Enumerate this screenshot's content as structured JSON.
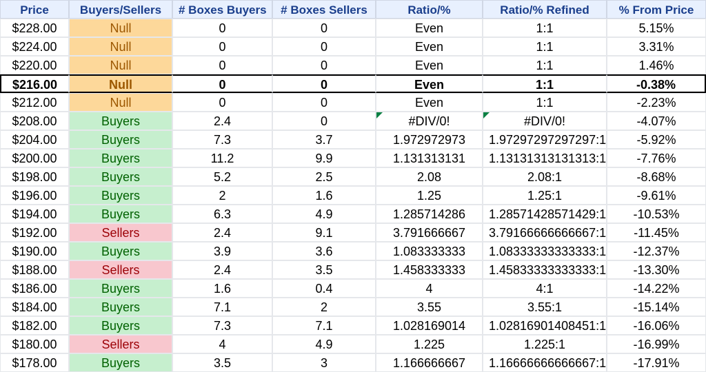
{
  "headers": [
    "Price",
    "Buyers/Sellers",
    "# Boxes Buyers",
    "# Boxes Sellers",
    "Ratio/%",
    "Ratio/% Refined",
    "% From Price"
  ],
  "rows": [
    {
      "price": "$228.00",
      "bs": "Null",
      "bs_class": "bs-null",
      "boxes_buyers": "0",
      "boxes_sellers": "0",
      "ratio": "Even",
      "ratio_refined": "1:1",
      "pct": "5.15%",
      "highlight": false,
      "err": false
    },
    {
      "price": "$224.00",
      "bs": "Null",
      "bs_class": "bs-null",
      "boxes_buyers": "0",
      "boxes_sellers": "0",
      "ratio": "Even",
      "ratio_refined": "1:1",
      "pct": "3.31%",
      "highlight": false,
      "err": false
    },
    {
      "price": "$220.00",
      "bs": "Null",
      "bs_class": "bs-null",
      "boxes_buyers": "0",
      "boxes_sellers": "0",
      "ratio": "Even",
      "ratio_refined": "1:1",
      "pct": "1.46%",
      "highlight": false,
      "err": false
    },
    {
      "price": "$216.00",
      "bs": "Null",
      "bs_class": "bs-null",
      "boxes_buyers": "0",
      "boxes_sellers": "0",
      "ratio": "Even",
      "ratio_refined": "1:1",
      "pct": "-0.38%",
      "highlight": true,
      "err": false
    },
    {
      "price": "$212.00",
      "bs": "Null",
      "bs_class": "bs-null",
      "boxes_buyers": "0",
      "boxes_sellers": "0",
      "ratio": "Even",
      "ratio_refined": "1:1",
      "pct": "-2.23%",
      "highlight": false,
      "err": false
    },
    {
      "price": "$208.00",
      "bs": "Buyers",
      "bs_class": "bs-buyers",
      "boxes_buyers": "2.4",
      "boxes_sellers": "0",
      "ratio": "#DIV/0!",
      "ratio_refined": "#DIV/0!",
      "pct": "-4.07%",
      "highlight": false,
      "err": true
    },
    {
      "price": "$204.00",
      "bs": "Buyers",
      "bs_class": "bs-buyers",
      "boxes_buyers": "7.3",
      "boxes_sellers": "3.7",
      "ratio": "1.972972973",
      "ratio_refined": "1.97297297297297:1",
      "pct": "-5.92%",
      "highlight": false,
      "err": false
    },
    {
      "price": "$200.00",
      "bs": "Buyers",
      "bs_class": "bs-buyers",
      "boxes_buyers": "11.2",
      "boxes_sellers": "9.9",
      "ratio": "1.131313131",
      "ratio_refined": "1.13131313131313:1",
      "pct": "-7.76%",
      "highlight": false,
      "err": false
    },
    {
      "price": "$198.00",
      "bs": "Buyers",
      "bs_class": "bs-buyers",
      "boxes_buyers": "5.2",
      "boxes_sellers": "2.5",
      "ratio": "2.08",
      "ratio_refined": "2.08:1",
      "pct": "-8.68%",
      "highlight": false,
      "err": false
    },
    {
      "price": "$196.00",
      "bs": "Buyers",
      "bs_class": "bs-buyers",
      "boxes_buyers": "2",
      "boxes_sellers": "1.6",
      "ratio": "1.25",
      "ratio_refined": "1.25:1",
      "pct": "-9.61%",
      "highlight": false,
      "err": false
    },
    {
      "price": "$194.00",
      "bs": "Buyers",
      "bs_class": "bs-buyers",
      "boxes_buyers": "6.3",
      "boxes_sellers": "4.9",
      "ratio": "1.285714286",
      "ratio_refined": "1.28571428571429:1",
      "pct": "-10.53%",
      "highlight": false,
      "err": false
    },
    {
      "price": "$192.00",
      "bs": "Sellers",
      "bs_class": "bs-sellers",
      "boxes_buyers": "2.4",
      "boxes_sellers": "9.1",
      "ratio": "3.791666667",
      "ratio_refined": "3.79166666666667:1",
      "pct": "-11.45%",
      "highlight": false,
      "err": false
    },
    {
      "price": "$190.00",
      "bs": "Buyers",
      "bs_class": "bs-buyers",
      "boxes_buyers": "3.9",
      "boxes_sellers": "3.6",
      "ratio": "1.083333333",
      "ratio_refined": "1.08333333333333:1",
      "pct": "-12.37%",
      "highlight": false,
      "err": false
    },
    {
      "price": "$188.00",
      "bs": "Sellers",
      "bs_class": "bs-sellers",
      "boxes_buyers": "2.4",
      "boxes_sellers": "3.5",
      "ratio": "1.458333333",
      "ratio_refined": "1.45833333333333:1",
      "pct": "-13.30%",
      "highlight": false,
      "err": false
    },
    {
      "price": "$186.00",
      "bs": "Buyers",
      "bs_class": "bs-buyers",
      "boxes_buyers": "1.6",
      "boxes_sellers": "0.4",
      "ratio": "4",
      "ratio_refined": "4:1",
      "pct": "-14.22%",
      "highlight": false,
      "err": false
    },
    {
      "price": "$184.00",
      "bs": "Buyers",
      "bs_class": "bs-buyers",
      "boxes_buyers": "7.1",
      "boxes_sellers": "2",
      "ratio": "3.55",
      "ratio_refined": "3.55:1",
      "pct": "-15.14%",
      "highlight": false,
      "err": false
    },
    {
      "price": "$182.00",
      "bs": "Buyers",
      "bs_class": "bs-buyers",
      "boxes_buyers": "7.3",
      "boxes_sellers": "7.1",
      "ratio": "1.028169014",
      "ratio_refined": "1.02816901408451:1",
      "pct": "-16.06%",
      "highlight": false,
      "err": false
    },
    {
      "price": "$180.00",
      "bs": "Sellers",
      "bs_class": "bs-sellers",
      "boxes_buyers": "4",
      "boxes_sellers": "4.9",
      "ratio": "1.225",
      "ratio_refined": "1.225:1",
      "pct": "-16.99%",
      "highlight": false,
      "err": false
    },
    {
      "price": "$178.00",
      "bs": "Buyers",
      "bs_class": "bs-buyers",
      "boxes_buyers": "3.5",
      "boxes_sellers": "3",
      "ratio": "1.166666667",
      "ratio_refined": "1.16666666666667:1",
      "pct": "-17.91%",
      "highlight": false,
      "err": false
    }
  ]
}
